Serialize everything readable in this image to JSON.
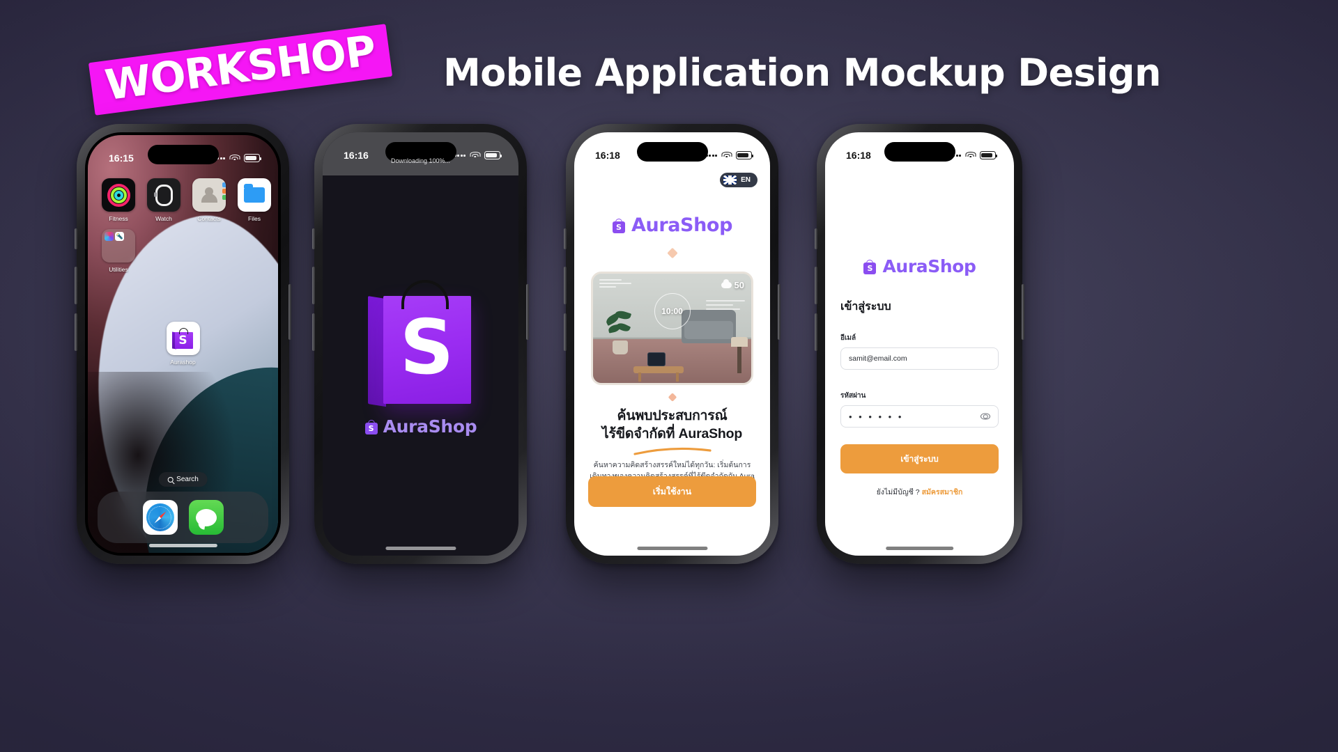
{
  "header": {
    "badge": "WORKSHOP",
    "title": "Mobile Application Mockup Design",
    "badge_color": "#F516F5",
    "title_color": "#FFFFFF"
  },
  "brand": {
    "name": "AuraShop",
    "purple": "#8B5CF6",
    "orange": "#ED9C3D",
    "bag_letter": "S"
  },
  "phone1": {
    "label": "home-screen",
    "status": {
      "time": "16:15"
    },
    "apps_row1": [
      {
        "label": "Fitness",
        "icon": "fitness-rings-icon"
      },
      {
        "label": "Watch",
        "icon": "watch-icon"
      },
      {
        "label": "Contacts",
        "icon": "contacts-icon"
      },
      {
        "label": "Files",
        "icon": "files-folder-icon"
      }
    ],
    "apps_row2": [
      {
        "label": "Utilities",
        "icon": "utilities-folder-icon"
      }
    ],
    "featured_app": {
      "label": "Aurashop",
      "icon": "aurashop-bag-icon"
    },
    "search_pill": "Search",
    "dock": [
      {
        "label": "Safari",
        "icon": "safari-compass-icon"
      },
      {
        "label": "Messages",
        "icon": "messages-bubble-icon"
      }
    ]
  },
  "phone2": {
    "label": "splash-screen",
    "status": {
      "time": "16:16"
    },
    "notification": "Downloading 100%...",
    "wordmark": "AuraShop",
    "bag_letter": "S",
    "background": "#15141C"
  },
  "phone3": {
    "label": "onboarding-screen",
    "status": {
      "time": "16:18"
    },
    "language": {
      "code": "EN",
      "flag": "uk-flag-icon"
    },
    "wordmark": "AuraShop",
    "hero": {
      "clock": "10:00",
      "temperature": "50",
      "weather_icon": "cloud-icon"
    },
    "title_line1": "ค้นพบประสบการณ์",
    "title_line2": "ไร้ขีดจำกัดที่ AuraShop",
    "body": "ค้นหาความคิดสร้างสรรค์ใหม่ได้ทุกวัน: เริ่มต้นการเดินทางของความคิดสร้างสรรค์ที่ไร้ขีดจำกัดกับ Aura",
    "cta": "เริ่มใช้งาน"
  },
  "phone4": {
    "label": "login-screen",
    "status": {
      "time": "16:18"
    },
    "wordmark": "AuraShop",
    "heading": "เข้าสู่ระบบ",
    "email": {
      "label": "อีเมล์",
      "value": "samit@email.com"
    },
    "password": {
      "label": "รหัสผ่าน",
      "value": "• • • • • •",
      "toggle": "eye-icon"
    },
    "submit": "เข้าสู่ระบบ",
    "footer_text": "ยังไม่มีบัญชี ?",
    "footer_link": "สมัครสมาชิก"
  }
}
